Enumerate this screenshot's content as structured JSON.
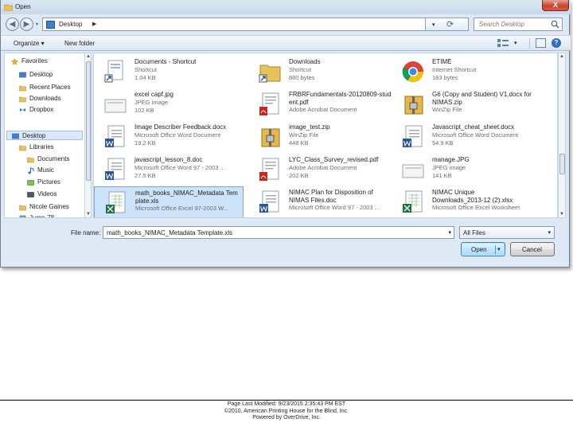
{
  "window": {
    "title": "Open",
    "close_label": "X"
  },
  "address_bar": {
    "location": "Desktop",
    "search_placeholder": "Search Desktop"
  },
  "toolbar": {
    "organize_label": "Organize ▾",
    "new_folder_label": "New folder"
  },
  "nav_pane": {
    "items": [
      {
        "label": "Favorites",
        "icon": "star-icon",
        "level": 0
      },
      {
        "label": "Desktop",
        "icon": "desktop-icon",
        "level": 1
      },
      {
        "label": "Recent Places",
        "icon": "recent-places-icon",
        "level": 1
      },
      {
        "label": "Downloads",
        "icon": "downloads-folder-icon",
        "level": 1
      },
      {
        "label": "Dropbox",
        "icon": "dropbox-icon",
        "level": 1
      },
      {
        "label": "Desktop",
        "icon": "desktop-icon",
        "level": 0,
        "selected": true
      },
      {
        "label": "Libraries",
        "icon": "libraries-icon",
        "level": 1
      },
      {
        "label": "Documents",
        "icon": "documents-icon",
        "level": 2
      },
      {
        "label": "Music",
        "icon": "music-icon",
        "level": 2
      },
      {
        "label": "Pictures",
        "icon": "pictures-icon",
        "level": 2
      },
      {
        "label": "Videos",
        "icon": "videos-icon",
        "level": 2
      },
      {
        "label": "Nicole Gaines",
        "icon": "user-folder-icon",
        "level": 1
      },
      {
        "label": "Jump-78",
        "icon": "computer-icon",
        "level": 1
      }
    ]
  },
  "files": [
    {
      "name": "Documents - Shortcut",
      "type": "Shortcut",
      "size": "1.04 KB",
      "icon": "shortcut-icon"
    },
    {
      "name": "Downloads",
      "type": "Shortcut",
      "size": "880 bytes",
      "icon": "folder-shortcut-icon"
    },
    {
      "name": "ETIME",
      "type": "Internet Shortcut",
      "size": "183 bytes",
      "icon": "chrome-icon"
    },
    {
      "name": "excel capf.jpg",
      "type": "JPEG image",
      "size": "102 KB",
      "icon": "image-file-icon"
    },
    {
      "name": "FRBRFundamentals-20120809-stud",
      "name2": "ent.pdf",
      "type": "Adobe Acrobat Document",
      "size": "",
      "icon": "pdf-icon"
    },
    {
      "name": "G6 (Copy and Student) V1.docx for",
      "name2": "NIMAS.zip",
      "type": "WinZip File",
      "size": "",
      "icon": "zip-icon"
    },
    {
      "name": "Image Describer Feedback.docx",
      "type": "Microsoft Office Word Document",
      "size": "19.2 KB",
      "icon": "word-doc-icon"
    },
    {
      "name": "image_test.zip",
      "type": "WinZip File",
      "size": "448 KB",
      "icon": "zip-icon"
    },
    {
      "name": "Javascript_cheat_sheet.docx",
      "type": "Microsoft Office Word Document",
      "size": "54.9 KB",
      "icon": "word-doc-icon"
    },
    {
      "name": "javascript_lesson_8.doc",
      "type": "Microsoft Office Word 97 - 2003 ...",
      "size": "27.5 KB",
      "icon": "word-doc-icon"
    },
    {
      "name": "LYC_Class_Survey_revised.pdf",
      "type": "Adobe Acrobat Document",
      "size": "202 KB",
      "icon": "pdf-icon"
    },
    {
      "name": "manage.JPG",
      "type": "JPEG image",
      "size": "141 KB",
      "icon": "image-file-icon"
    },
    {
      "name": "math_books_NIMAC_Metadata Tem",
      "name2": "plate.xls",
      "type": "Microsoft Office Excel 97-2003 W...",
      "size": "",
      "icon": "excel-file-icon",
      "selected": true
    },
    {
      "name": "NIMAC Plan for Disposition of",
      "name2": "NIMAS Files.doc",
      "type": "Microsoft Office Word 97 - 2003 ...",
      "size": "",
      "icon": "word-doc-icon"
    },
    {
      "name": "NIMAC Unique",
      "name2": "Downloads_2013-12 (2).xlsx",
      "type": "Microsoft Office Excel Worksheet",
      "size": "",
      "icon": "excel-file-icon"
    }
  ],
  "file_name": {
    "label": "File name:",
    "value": "math_books_NIMAC_Metadata Template.xls"
  },
  "file_type": {
    "value": "All Files"
  },
  "buttons": {
    "open": "Open",
    "cancel": "Cancel"
  },
  "footer": {
    "line1": "Page Last Modified: 9/23/2015 2:35:43 PM EST",
    "line2": "©2010, American Printing House for the Blind, Inc.",
    "line3": "Powered by OverDrive, Inc."
  },
  "colors": {
    "accent": "#3c7fb1",
    "selection": "#cde3fa",
    "close": "#c7452e"
  }
}
